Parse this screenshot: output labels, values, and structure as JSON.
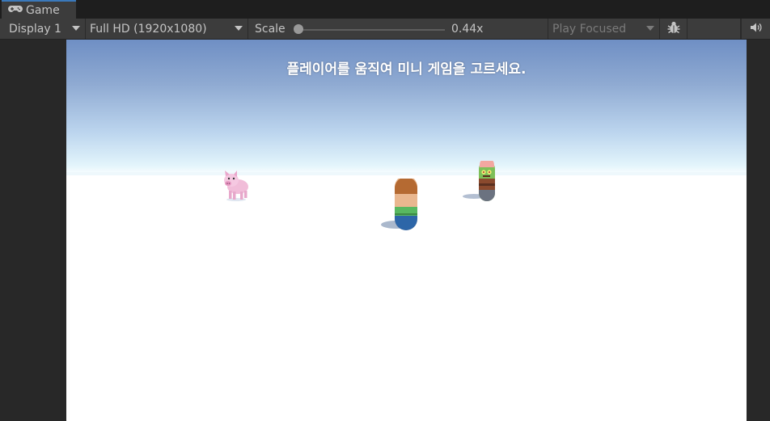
{
  "tab": {
    "label": "Game",
    "icon": "gamepad-icon"
  },
  "toolbar": {
    "display": "Display 1",
    "resolution": "Full HD (1920x1080)",
    "scale_label": "Scale",
    "scale_value": "0.44x",
    "play_mode": "Play Focused",
    "debug_icon": "bug-icon",
    "audio_icon": "speaker-icon"
  },
  "game": {
    "instruction": "플레이어를 움직여 미니 게임을 고르세요.",
    "characters": [
      "pig",
      "player-capsule",
      "zombie-capsule"
    ]
  },
  "colors": {
    "accent": "#3a79bb",
    "sky_top": "#6f8fc4",
    "ground": "#ffffff"
  }
}
